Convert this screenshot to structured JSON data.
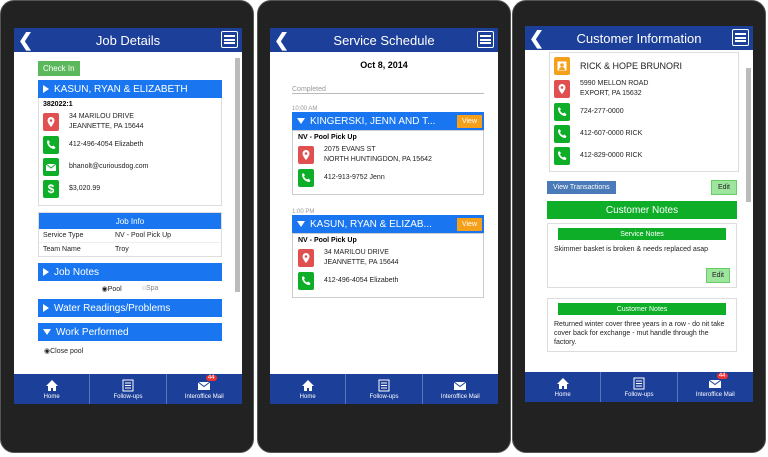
{
  "tabs": {
    "home": "Home",
    "followups": "Follow-ups",
    "mail": "Interoffice Mail",
    "badge": "44"
  },
  "job": {
    "title": "Job Details",
    "check_in": "Check In",
    "customer": "KASUN, RYAN & ELIZABETH",
    "account": "382022:1",
    "address1": "34 MARILOU DRIVE",
    "address2": "JEANNETTE, PA 15644",
    "phone": "412-496-4054 Elizabeth",
    "email": "bhanolt@curiousdog.com",
    "balance": "$3,020.99",
    "job_info_title": "Job Info",
    "service_type_label": "Service Type",
    "service_type_value": "NV - Pool Pick Up",
    "team_name_label": "Team Name",
    "team_name_value": "Troy",
    "job_notes": "Job Notes",
    "pool_label": "Pool",
    "spa_label": "Spa",
    "water_readings": "Water Readings/Problems",
    "work_performed": "Work Performed",
    "work_item": "Close pool"
  },
  "schedule": {
    "title": "Service Schedule",
    "date": "Oct 8, 2014",
    "completed": "Completed",
    "appointments": [
      {
        "time": "10:00 AM",
        "name": "KINGERSKI, JENN AND T...",
        "view": "View",
        "service": "NV - Pool Pick Up",
        "address1": "2075 EVANS ST",
        "address2": "NORTH HUNTINGDON, PA 15642",
        "phone": "412-913-9752 Jenn"
      },
      {
        "time": "1:00 PM",
        "name": "KASUN, RYAN & ELIZAB...",
        "view": "View",
        "service": "NV - Pool Pick Up",
        "address1": "34 MARILOU DRIVE",
        "address2": "JEANNETTE, PA 15644",
        "phone": "412-496-4054 Elizabeth"
      }
    ]
  },
  "customer": {
    "title": "Customer Information",
    "name": "RICK & HOPE BRUNORI",
    "address1": "5990 MELLON ROAD",
    "address2": "EXPORT, PA 15632",
    "phone1": "724-277-0000",
    "phone2": "412-607-0000 RICK",
    "phone3": "412-829-0000 RICK",
    "view_transactions": "View Transactions",
    "edit": "Edit",
    "notes_title": "Customer Notes",
    "service_notes_title": "Service Notes",
    "service_note": "Skimmer basket is broken & needs replaced asap",
    "edit2": "Edit",
    "customer_notes_sub": "Customer Notes",
    "customer_note": "Returned winter cover three years in a row - do nit take cover back for exchange - mut handle through the factory."
  },
  "colors": {
    "header": "#1c3f99",
    "accent": "#1976f0",
    "green": "#0fae28",
    "red": "#e05050",
    "orange": "#f5a01a"
  }
}
